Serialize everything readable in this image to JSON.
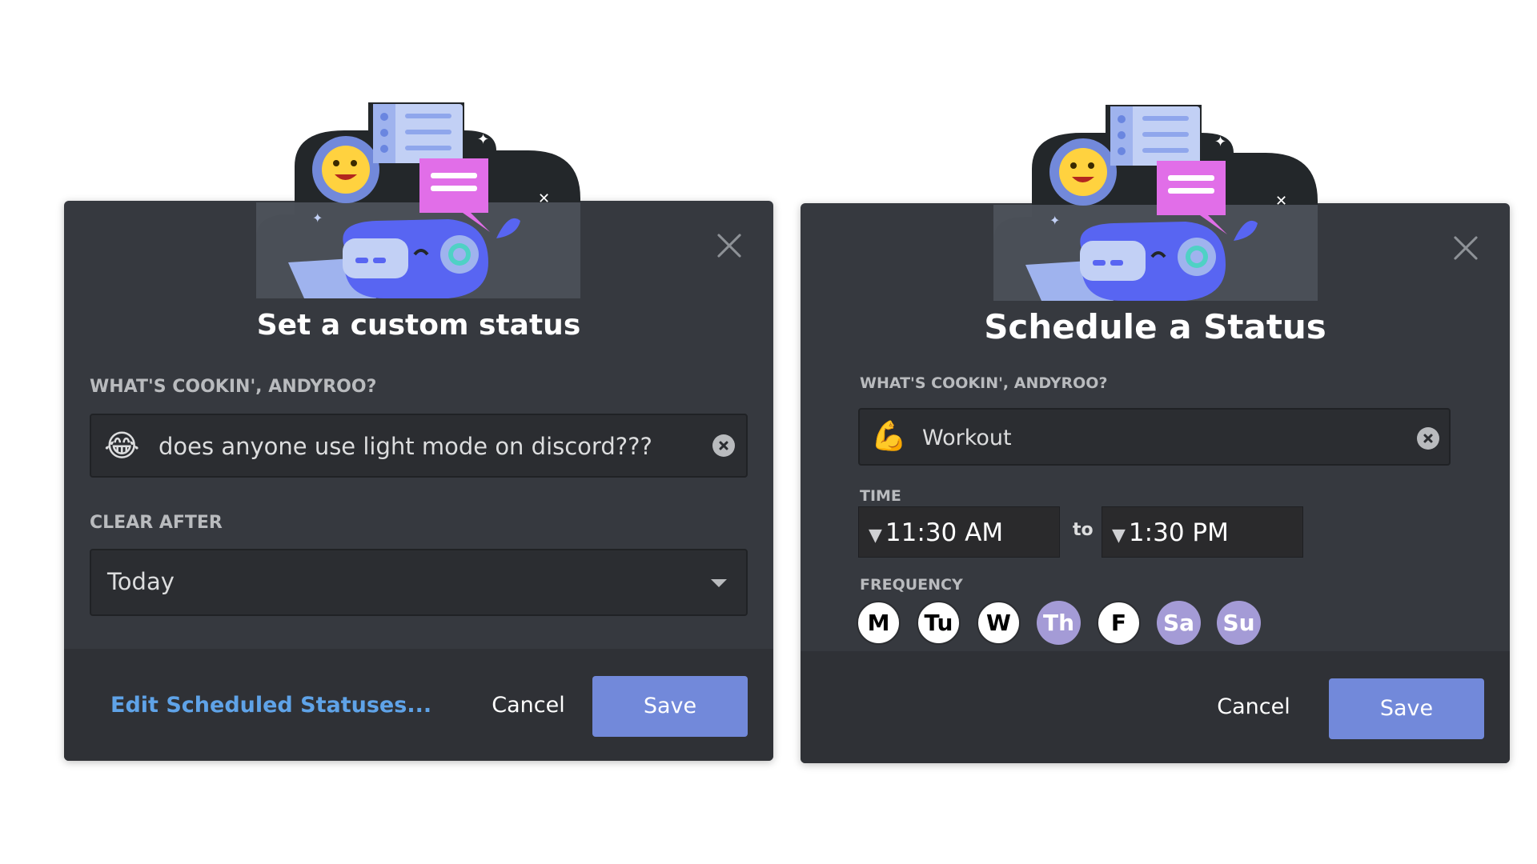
{
  "left_dialog": {
    "title": "Set a custom status",
    "status_label": "WHAT'S COOKIN', ANDYROO?",
    "status_emoji": "😂",
    "status_emoji_name": "joy-emoji",
    "status_value": "does anyone use light mode on discord???",
    "clear_after_label": "CLEAR AFTER",
    "clear_after_value": "Today",
    "edit_link": "Edit Scheduled Statuses...",
    "cancel_label": "Cancel",
    "save_label": "Save"
  },
  "right_dialog": {
    "title": "Schedule a Status",
    "status_label": "WHAT'S COOKIN', ANDYROO?",
    "status_emoji": "💪",
    "status_emoji_name": "flexed-biceps-emoji",
    "status_value": "Workout",
    "time_label": "TIME",
    "time_start": "11:30 AM",
    "time_separator": "to",
    "time_end": "1:30 PM",
    "frequency_label": "FREQUENCY",
    "days": [
      {
        "label": "M",
        "selected": true
      },
      {
        "label": "Tu",
        "selected": true
      },
      {
        "label": "W",
        "selected": true
      },
      {
        "label": "Th",
        "selected": false
      },
      {
        "label": "F",
        "selected": true
      },
      {
        "label": "Sa",
        "selected": false
      },
      {
        "label": "Su",
        "selected": false
      }
    ],
    "cancel_label": "Cancel",
    "save_label": "Save"
  },
  "colors": {
    "modal_bg": "#36393f",
    "footer_bg": "#2f3136",
    "accent": "#7289da",
    "link": "#5fa3e8",
    "day_unselected": "#a49bd6"
  }
}
